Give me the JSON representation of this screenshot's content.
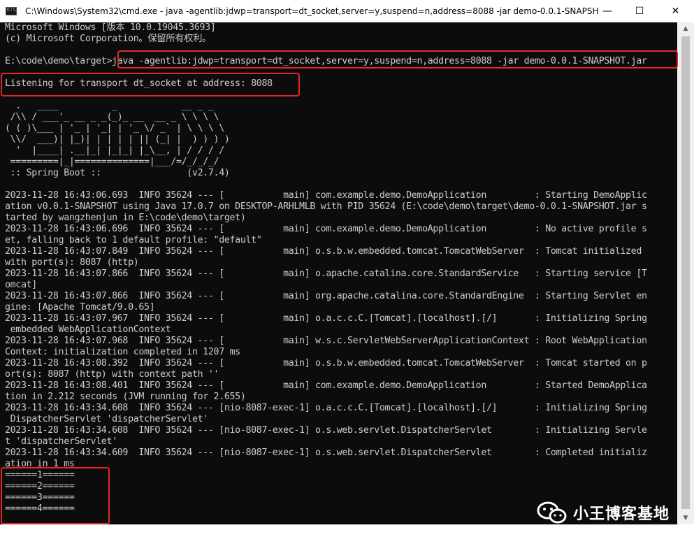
{
  "window": {
    "title": "C:\\Windows\\System32\\cmd.exe - java  -agentlib:jdwp=transport=dt_socket,server=y,suspend=n,address=8088 -jar demo-0.0.1-SNAPSH...",
    "minimize_glyph": "—",
    "maximize_glyph": "☐",
    "close_glyph": "✕"
  },
  "console": {
    "lines": [
      "Microsoft Windows [版本 10.0.19045.3693]",
      "(c) Microsoft Corporation。保留所有权利。",
      "",
      "E:\\code\\demo\\target>java -agentlib:jdwp=transport=dt_socket,server=y,suspend=n,address=8088 -jar demo-0.0.1-SNAPSHOT.jar",
      "",
      "Listening for transport dt_socket at address: 8088",
      "",
      "  .   ____          _            __ _ _",
      " /\\\\ / ___'_ __ _ _(_)_ __  __ _ \\ \\ \\ \\",
      "( ( )\\___ | '_ | '_| | '_ \\/ _` | \\ \\ \\ \\",
      " \\\\/  ___)| |_)| | | | | || (_| |  ) ) ) )",
      "  '  |____| .__|_| |_|_| |_\\__, | / / / /",
      " =========|_|==============|___/=/_/_/_/",
      " :: Spring Boot ::                (v2.7.4)",
      "",
      "2023-11-28 16:43:06.693  INFO 35624 --- [           main] com.example.demo.DemoApplication         : Starting DemoApplic",
      "ation v0.0.1-SNAPSHOT using Java 17.0.7 on DESKTOP-ARHLMLB with PID 35624 (E:\\code\\demo\\target\\demo-0.0.1-SNAPSHOT.jar s",
      "tarted by wangzhenjun in E:\\code\\demo\\target)",
      "2023-11-28 16:43:06.696  INFO 35624 --- [           main] com.example.demo.DemoApplication         : No active profile s",
      "et, falling back to 1 default profile: \"default\"",
      "2023-11-28 16:43:07.849  INFO 35624 --- [           main] o.s.b.w.embedded.tomcat.TomcatWebServer  : Tomcat initialized",
      "with port(s): 8087 (http)",
      "2023-11-28 16:43:07.866  INFO 35624 --- [           main] o.apache.catalina.core.StandardService   : Starting service [T",
      "omcat]",
      "2023-11-28 16:43:07.866  INFO 35624 --- [           main] org.apache.catalina.core.StandardEngine  : Starting Servlet en",
      "gine: [Apache Tomcat/9.0.65]",
      "2023-11-28 16:43:07.967  INFO 35624 --- [           main] o.a.c.c.C.[Tomcat].[localhost].[/]       : Initializing Spring",
      " embedded WebApplicationContext",
      "2023-11-28 16:43:07.968  INFO 35624 --- [           main] w.s.c.ServletWebServerApplicationContext : Root WebApplication",
      "Context: initialization completed in 1207 ms",
      "2023-11-28 16:43:08.392  INFO 35624 --- [           main] o.s.b.w.embedded.tomcat.TomcatWebServer  : Tomcat started on p",
      "ort(s): 8087 (http) with context path ''",
      "2023-11-28 16:43:08.401  INFO 35624 --- [           main] com.example.demo.DemoApplication         : Started DemoApplica",
      "tion in 2.212 seconds (JVM running for 2.655)",
      "2023-11-28 16:43:34.608  INFO 35624 --- [nio-8087-exec-1] o.a.c.c.C.[Tomcat].[localhost].[/]       : Initializing Spring",
      " DispatcherServlet 'dispatcherServlet'",
      "2023-11-28 16:43:34.608  INFO 35624 --- [nio-8087-exec-1] o.s.web.servlet.DispatcherServlet        : Initializing Servle",
      "t 'dispatcherServlet'",
      "2023-11-28 16:43:34.609  INFO 35624 --- [nio-8087-exec-1] o.s.web.servlet.DispatcherServlet        : Completed initializ",
      "ation in 1 ms",
      "======1======",
      "======2======",
      "======3======",
      "======4======",
      "_"
    ]
  },
  "watermark": {
    "text": "小王博客基地",
    "icon": "wechat-icon"
  },
  "colors": {
    "console_bg": "#0c0c0c",
    "console_fg": "#cccccc",
    "highlight": "#e4262b"
  }
}
